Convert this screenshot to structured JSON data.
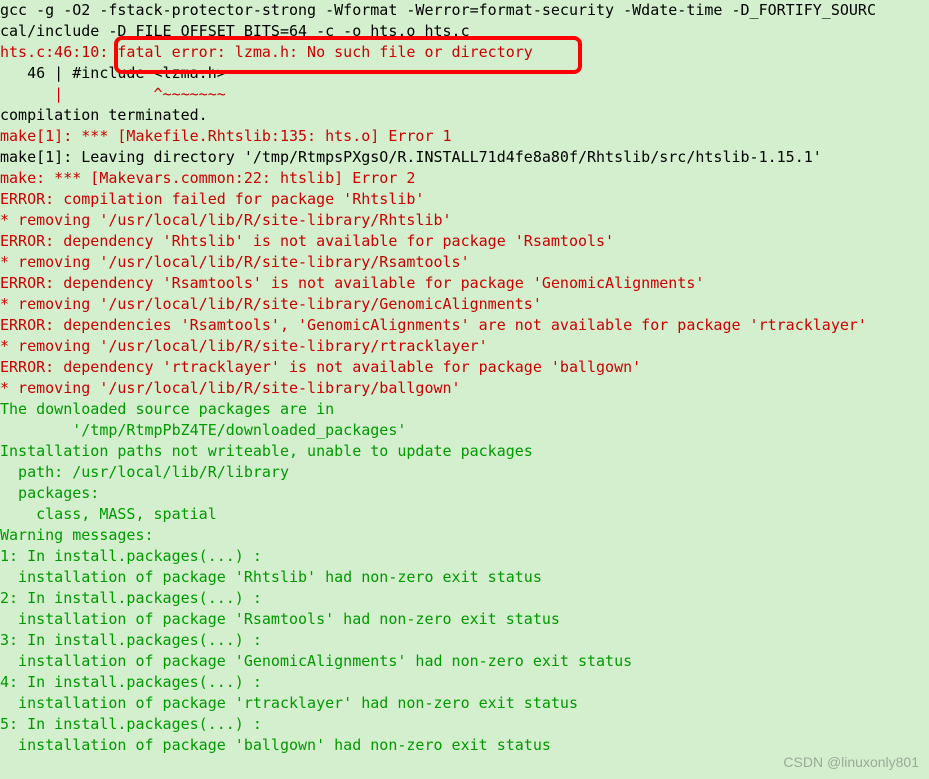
{
  "lines": [
    {
      "type": "plain",
      "cls": "c-black",
      "text": "gcc -g -O2 -fstack-protector-strong -Wformat -Werror=format-security -Wdate-time -D_FORTIFY_SOURC"
    },
    {
      "type": "plain",
      "cls": "c-black",
      "text": "cal/include -D_FILE_OFFSET_BITS=64 -c -o hts.o hts.c"
    },
    {
      "type": "mixed",
      "parts": [
        {
          "cls": "c-red",
          "text": "hts.c:46:10:"
        },
        {
          "cls": "c-red",
          "text": " fatal error: lzma.h: No such file or directory"
        }
      ]
    },
    {
      "type": "plain",
      "cls": "c-black",
      "text": "   46 | #include <lzma.h>"
    },
    {
      "type": "plain",
      "cls": "c-red",
      "text": "      |          ^~~~~~~~"
    },
    {
      "type": "plain",
      "cls": "c-black",
      "text": "compilation terminated."
    },
    {
      "type": "plain",
      "cls": "c-red",
      "text": "make[1]: *** [Makefile.Rhtslib:135: hts.o] Error 1"
    },
    {
      "type": "plain",
      "cls": "c-black",
      "text": "make[1]: Leaving directory '/tmp/RtmpsPXgsO/R.INSTALL71d4fe8a80f/Rhtslib/src/htslib-1.15.1'"
    },
    {
      "type": "plain",
      "cls": "c-red",
      "text": "make: *** [Makevars.common:22: htslib] Error 2"
    },
    {
      "type": "plain",
      "cls": "c-red",
      "text": "ERROR: compilation failed for package 'Rhtslib'"
    },
    {
      "type": "plain",
      "cls": "c-red",
      "text": "* removing '/usr/local/lib/R/site-library/Rhtslib'"
    },
    {
      "type": "plain",
      "cls": "c-red",
      "text": "ERROR: dependency 'Rhtslib' is not available for package 'Rsamtools'"
    },
    {
      "type": "plain",
      "cls": "c-red",
      "text": "* removing '/usr/local/lib/R/site-library/Rsamtools'"
    },
    {
      "type": "plain",
      "cls": "c-red",
      "text": "ERROR: dependency 'Rsamtools' is not available for package 'GenomicAlignments'"
    },
    {
      "type": "plain",
      "cls": "c-red",
      "text": "* removing '/usr/local/lib/R/site-library/GenomicAlignments'"
    },
    {
      "type": "plain",
      "cls": "c-red",
      "text": "ERROR: dependencies 'Rsamtools', 'GenomicAlignments' are not available for package 'rtracklayer'"
    },
    {
      "type": "plain",
      "cls": "c-red",
      "text": "* removing '/usr/local/lib/R/site-library/rtracklayer'"
    },
    {
      "type": "plain",
      "cls": "c-red",
      "text": "ERROR: dependency 'rtracklayer' is not available for package 'ballgown'"
    },
    {
      "type": "plain",
      "cls": "c-red",
      "text": "* removing '/usr/local/lib/R/site-library/ballgown'"
    },
    {
      "type": "plain",
      "cls": "c-green",
      "text": ""
    },
    {
      "type": "plain",
      "cls": "c-green",
      "text": "The downloaded source packages are in"
    },
    {
      "type": "plain",
      "cls": "c-green",
      "text": "        '/tmp/RtmpPbZ4TE/downloaded_packages'"
    },
    {
      "type": "plain",
      "cls": "c-green",
      "text": "Installation paths not writeable, unable to update packages"
    },
    {
      "type": "plain",
      "cls": "c-green",
      "text": "  path: /usr/local/lib/R/library"
    },
    {
      "type": "plain",
      "cls": "c-green",
      "text": "  packages:"
    },
    {
      "type": "plain",
      "cls": "c-green",
      "text": "    class, MASS, spatial"
    },
    {
      "type": "plain",
      "cls": "c-green",
      "text": "Warning messages:"
    },
    {
      "type": "plain",
      "cls": "c-green",
      "text": "1: In install.packages(...) :"
    },
    {
      "type": "plain",
      "cls": "c-green",
      "text": "  installation of package 'Rhtslib' had non-zero exit status"
    },
    {
      "type": "plain",
      "cls": "c-green",
      "text": "2: In install.packages(...) :"
    },
    {
      "type": "plain",
      "cls": "c-green",
      "text": "  installation of package 'Rsamtools' had non-zero exit status"
    },
    {
      "type": "plain",
      "cls": "c-green",
      "text": "3: In install.packages(...) :"
    },
    {
      "type": "plain",
      "cls": "c-green",
      "text": "  installation of package 'GenomicAlignments' had non-zero exit status"
    },
    {
      "type": "plain",
      "cls": "c-green",
      "text": "4: In install.packages(...) :"
    },
    {
      "type": "plain",
      "cls": "c-green",
      "text": "  installation of package 'rtracklayer' had non-zero exit status"
    },
    {
      "type": "plain",
      "cls": "c-green",
      "text": "5: In install.packages(...) :"
    },
    {
      "type": "plain",
      "cls": "c-green",
      "text": "  installation of package 'ballgown' had non-zero exit status"
    }
  ],
  "watermark": "CSDN @linuxonly801"
}
